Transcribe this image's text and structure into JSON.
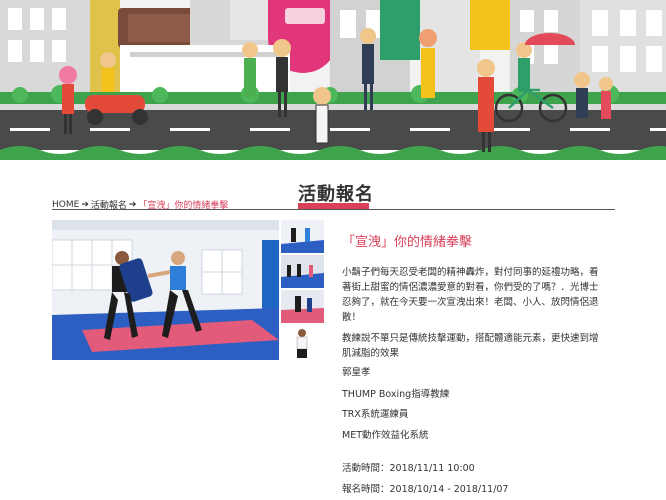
{
  "section": {
    "title": "活動報名"
  },
  "breadcrumb": {
    "home": "HOME",
    "level1": "活動報名",
    "current": "「宣洩」你的情緒拳擊"
  },
  "event": {
    "title": "「宣洩」你的情緒拳擊",
    "description": "小鬍子們每天忍受老闆的精神轟炸，對付同事的延禮功略，看著街上甜蜜的情侶濃濃愛意的對看，你們受的了嗎？．光博士忍夠了，就在今天要一次宣洩出來！老闆、小人、放閃情侶退散！",
    "description2": "教練說不單只是傳統技擊運動，搭配體適能元素，更快速到增肌減脂的效果",
    "coach_name": "郭皇孝",
    "credentials": [
      "THUMP Boxing指導教練",
      "TRX系統運練員",
      "MET動作效益化系統"
    ],
    "activity_time_label": "活動時間：2018/11/11 10:00",
    "signup_time_label": "報名時間：2018/10/14 - 2018/11/07"
  },
  "colors": {
    "accent": "#d9405a",
    "road": "#4a4a4a",
    "grass": "#4caf50"
  },
  "icons": {
    "breadcrumb_separator": "arrow-right-icon"
  }
}
